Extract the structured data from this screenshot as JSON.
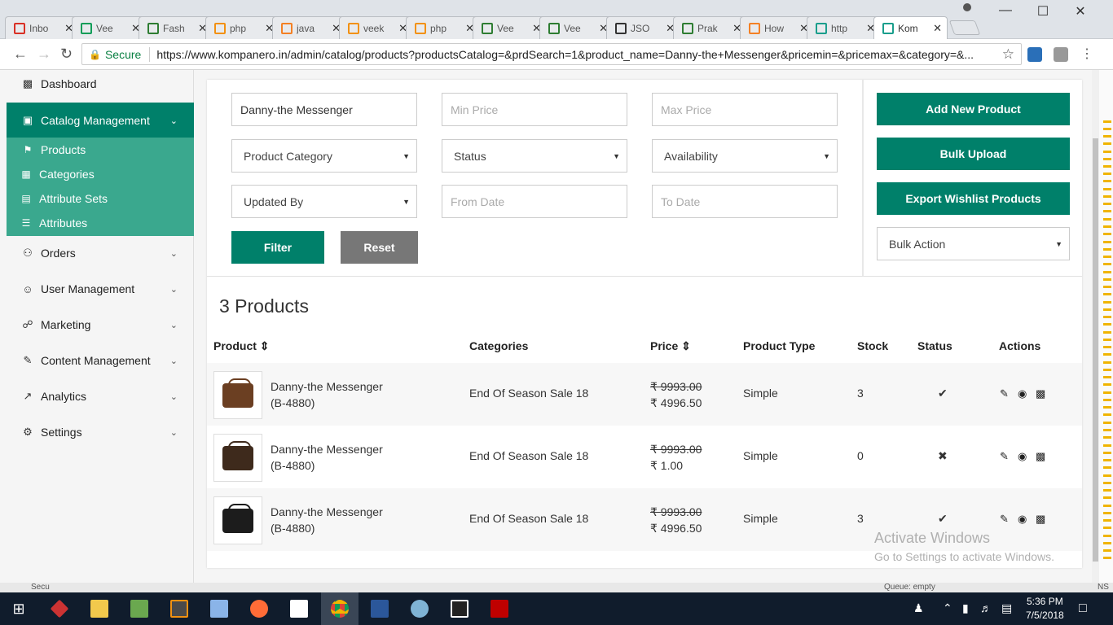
{
  "browser": {
    "tabs": [
      {
        "label": "Inbo",
        "icon": "gmail-icon",
        "color": "#d93025"
      },
      {
        "label": "Vee",
        "icon": "sheets-icon",
        "color": "#0f9d58"
      },
      {
        "label": "Fash",
        "icon": "wifi-icon",
        "color": "#2e7d32"
      },
      {
        "label": "php",
        "icon": "pma-icon",
        "color": "#f29111"
      },
      {
        "label": "java",
        "icon": "stackoverflow-icon",
        "color": "#f48024"
      },
      {
        "label": "veek",
        "icon": "pma-icon",
        "color": "#f29111"
      },
      {
        "label": "php",
        "icon": "pma-icon",
        "color": "#f29111"
      },
      {
        "label": "Vee",
        "icon": "wifi-icon",
        "color": "#2e7d32"
      },
      {
        "label": "Vee",
        "icon": "wifi-icon",
        "color": "#2e7d32"
      },
      {
        "label": "JSO",
        "icon": "json-icon",
        "color": "#333333"
      },
      {
        "label": "Prak",
        "icon": "wifi-icon",
        "color": "#2e7d32"
      },
      {
        "label": "How",
        "icon": "stackoverflow-icon",
        "color": "#f48024"
      },
      {
        "label": "http",
        "icon": "kompanero-icon",
        "color": "#1a9e8c"
      },
      {
        "label": "Kom",
        "icon": "kompanero-icon",
        "color": "#1a9e8c"
      }
    ],
    "secure_label": "Secure",
    "url": "https://www.kompanero.in/admin/catalog/products?productsCatalog=&prdSearch=1&product_name=Danny-the+Messenger&pricemin=&pricemax=&category=&..."
  },
  "sidebar": {
    "dashboard": "Dashboard",
    "catalog": "Catalog Management",
    "sub": [
      "Products",
      "Categories",
      "Attribute Sets",
      "Attributes"
    ],
    "items": [
      "Orders",
      "User Management",
      "Marketing",
      "Content Management",
      "Analytics",
      "Settings"
    ]
  },
  "filters": {
    "product_name": "Danny-the Messenger",
    "min_price": "Min Price",
    "max_price": "Max Price",
    "category": "Product Category",
    "status": "Status",
    "availability": "Availability",
    "updated_by": "Updated By",
    "from_date": "From Date",
    "to_date": "To Date",
    "filter_btn": "Filter",
    "reset_btn": "Reset"
  },
  "actions": {
    "add": "Add New Product",
    "bulk_upload": "Bulk Upload",
    "export": "Export Wishlist Products",
    "bulk_action": "Bulk Action"
  },
  "list": {
    "count": "3 Products",
    "headers": [
      "Product",
      "Categories",
      "Price",
      "Product Type",
      "Stock",
      "Status",
      "Actions"
    ],
    "rows": [
      {
        "name": "Danny-the Messenger",
        "sku": "(B-4880)",
        "category": "End Of Season Sale 18",
        "old_price": "₹ 9993.00",
        "price": "₹ 4996.50",
        "type": "Simple",
        "stock": "3",
        "status": "✔",
        "bag_color": "#6b3f22"
      },
      {
        "name": "Danny-the Messenger",
        "sku": "(B-4880)",
        "category": "End Of Season Sale 18",
        "old_price": "₹ 9993.00",
        "price": "₹ 1.00",
        "type": "Simple",
        "stock": "0",
        "status": "✖",
        "bag_color": "#3e2a1c"
      },
      {
        "name": "Danny-the Messenger",
        "sku": "(B-4880)",
        "category": "End Of Season Sale 18",
        "old_price": "₹ 9993.00",
        "price": "₹ 4996.50",
        "type": "Simple",
        "stock": "3",
        "status": "✔",
        "bag_color": "#1c1c1c"
      }
    ]
  },
  "watermark": {
    "title": "Activate Windows",
    "sub": "Go to Settings to activate Windows."
  },
  "behind_window": {
    "left": "Secu",
    "right": "Queue: empty",
    "far_right": "NS"
  },
  "taskbar": {
    "time": "5:36 PM",
    "date": "7/5/2018"
  }
}
